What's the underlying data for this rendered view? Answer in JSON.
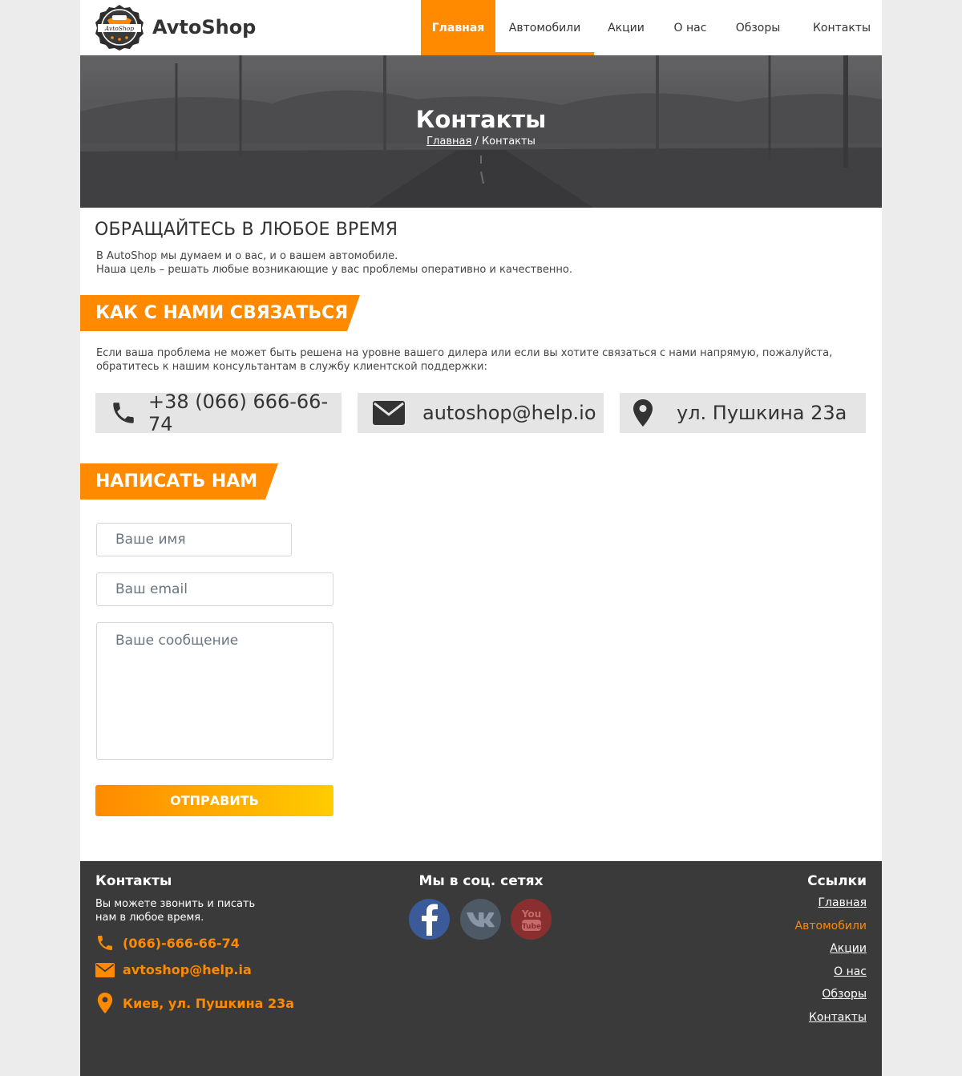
{
  "brand": {
    "name": "AvtoShop",
    "logo_text": "AvtoShop"
  },
  "nav": {
    "items": [
      {
        "label": "Главная"
      },
      {
        "label": "Автомобили"
      },
      {
        "label": "Акции"
      },
      {
        "label": "О нас"
      },
      {
        "label": "Обзоры"
      },
      {
        "label": "Контакты"
      }
    ]
  },
  "hero": {
    "title": "Контакты",
    "breadcrumb": {
      "home": "Главная",
      "separator": " / ",
      "current": "Контакты"
    }
  },
  "intro": {
    "heading": "ОБРАЩАЙТЕСЬ В ЛЮБОЕ ВРЕМЯ",
    "line1": "В AutoShop мы думаем и о вас, и о вашем автомобиле.",
    "line2": "Наша цель – решать любые возникающие у вас проблемы оперативно и качественно."
  },
  "contact_section": {
    "heading": "КАК С НАМИ СВЯЗАТЬСЯ",
    "text_line1": "Если ваша проблема не может быть решена на уровне вашего дилера или если вы хотите связаться с нами напрямую, пожалуйста,",
    "text_line2": "обратитесь к нашим консультантам в службу клиентской поддержки:",
    "phone": "+38 (066) 666-66-74",
    "email": "autoshop@help.io",
    "address": "ул. Пушкина 23а"
  },
  "form": {
    "heading": "НАПИСАТЬ НАМ",
    "name_placeholder": "Ваше имя",
    "email_placeholder": "Ваш email",
    "message_placeholder": "Ваше сообщение",
    "submit_label": "ОТПРАВИТЬ"
  },
  "footer": {
    "contacts_heading": "Контакты",
    "contacts_text_line1": "Вы можете звонить и писать",
    "contacts_text_line2": "нам в любое время.",
    "phone": "(066)-666-66-74",
    "email": "avtoshop@help.ia",
    "address": "Киев, ул. Пушкина 23а",
    "social_heading": "Мы в соц. сетях",
    "social_yt_label": "You Tube",
    "links_heading": "Ссылки",
    "links": [
      {
        "label": "Главная"
      },
      {
        "label": "Автомобили"
      },
      {
        "label": "Акции"
      },
      {
        "label": "О нас"
      },
      {
        "label": "Обзоры"
      },
      {
        "label": "Контакты"
      }
    ]
  },
  "colors": {
    "accent": "#ff8a00",
    "accent_end": "#ffcc00",
    "footer_bg": "#3a3a3a",
    "box_bg": "#e5e5e5"
  },
  "icons": {
    "phone": "phone-icon",
    "email": "envelope-icon",
    "address": "map-marker-icon",
    "facebook": "facebook-icon",
    "vk": "vk-icon",
    "youtube": "youtube-icon"
  }
}
